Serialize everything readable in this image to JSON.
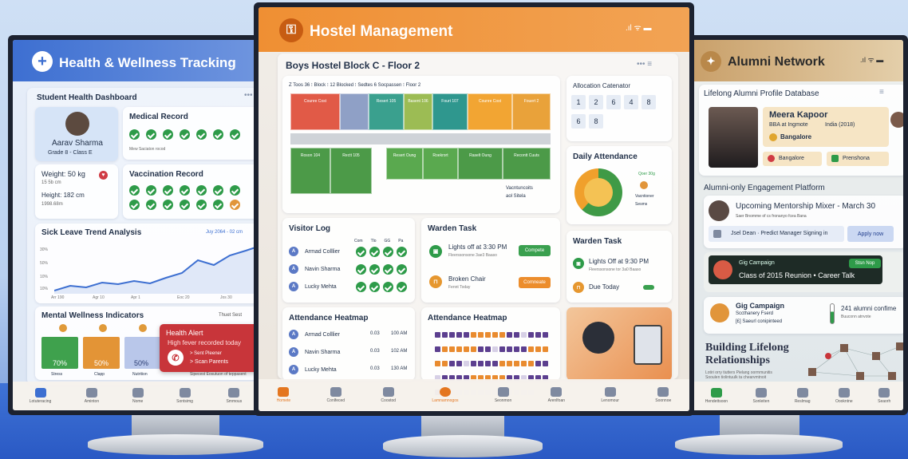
{
  "health": {
    "title": "Health & Wellness Tracking",
    "dashboard_title": "Student Health Dashboard",
    "student": {
      "name": "Aarav Sharma",
      "grade": "Grade 8 - Class E"
    },
    "weight": "Weight: 50 kg",
    "weight_sub": "15 5b cm",
    "height": "Height: 182 cm",
    "height_sub": "1998.68m",
    "medical_title": "Medical Record",
    "medical_sub": "Mew Saciaton rocod",
    "vaccination_title": "Vaccination Record",
    "sick_title": "Sick Leave Trend Analysis",
    "sick_legend": "Juy 2064 - 02 cm",
    "sick_yticks": [
      "30%",
      "50%",
      "10%",
      "10%"
    ],
    "sick_xticks": [
      "Arr 190",
      "Agr 10",
      "Apr 1",
      "Eoc 20",
      "Jos 30"
    ],
    "mental_title": "Mental Wellness Indicators",
    "mental_btn": "Thuet Sest",
    "bars": [
      {
        "label": "Stress",
        "value": "70%"
      },
      {
        "label": "Clapp",
        "value": "50%"
      },
      {
        "label": "Nutrition",
        "value": "50%"
      }
    ],
    "alert_title": "Health Alert",
    "alert_msg": "High fever recorded today",
    "alert_action1": "> Sent Pleener",
    "alert_action2": "> Scan Parents",
    "alert_footer": "Sipecest Eosutuon of teppasent",
    "nav": [
      "Lotuteracing",
      "Aminton",
      "Nome",
      "Sontsimg",
      "Smmous"
    ]
  },
  "hostel": {
    "title": "Hostel Management",
    "block_title": "Boys Hostel Block C - Floor 2",
    "floor_info": "Z  Toos 36  ⁝  Block  ⁝  12 Blocked  ⁝  Sedtes  6  Socpassen  ⁝  Floor 2",
    "rooms_top": [
      "Counre Cost",
      "",
      "Resert 105",
      "Basent 106",
      "Fourt 107",
      "Counre Cost",
      "Fouert 2"
    ],
    "rooms_bottom": [
      "Roson 104",
      "Rectt 105",
      "Resert Oung",
      "Roekrort",
      "Raselt Oung",
      "Recontt Cuuts"
    ],
    "floor_legend1": "Vacntuncoits",
    "floor_legend2": "aol Sitela",
    "calendar_title": "Allocation Catenator",
    "calendar_cells": [
      "1",
      "2",
      "6",
      "4",
      "8",
      "6",
      "8"
    ],
    "attendance_title": "Daily Attendance",
    "attendance_legend1": "Qoer 30g",
    "attendance_legend2": "Vacntioner",
    "attendance_legend3": "Sesms",
    "visitor_title": "Visitor Log",
    "visitor_cols": [
      "Com",
      "Tlo",
      "GG",
      "Pa"
    ],
    "visitors": [
      "Armad Colllier",
      "Navin Sharma",
      "Lucky Mehta"
    ],
    "warden1_title": "Warden Task",
    "warden1_task1": "Lights off at 3:30 PM",
    "warden1_task1_sub": "Fleerssonsone 3ae3 Baaso",
    "warden1_task1_btn": "Compete",
    "warden1_task2": "Broken Chair",
    "warden1_task2_sub": "Fennt Today",
    "warden1_task2_btn": "Comneate",
    "warden2_title": "Warden Task",
    "warden2_task1": "Lights Off at 9:30 PM",
    "warden2_task1_sub": "Fleerssonsone tor 3a0 Baaso",
    "warden2_task2": "Due Today",
    "heat1_title": "Attendance Heatmap",
    "heat1_rows": [
      {
        "name": "Armad Colllier",
        "v": "0.03",
        "t": "100 AM"
      },
      {
        "name": "Navin Sharma",
        "v": "0.03",
        "t": "102 AM"
      },
      {
        "name": "Lucky Mehta",
        "v": "0.03",
        "t": "130 AM"
      }
    ],
    "heat2_title": "Attendance Heatmap",
    "nav": [
      "Homete",
      "Conlfeced",
      "Coostod",
      "Lamnamnogos",
      "Seonmon",
      "Arenlfoan",
      "Lenomour",
      "Soonnoe"
    ]
  },
  "alumni": {
    "title": "Alumni Network",
    "db_title": "Lifelong Alumni Profile Database",
    "profile": {
      "name": "Meera Kapoor",
      "degree": "BBA at Ingmote",
      "location_year": "India (2018)",
      "city": "Bangalore"
    },
    "tag1": "Bangalore",
    "tag2": "Prenshona",
    "engage_title": "Alumni-only Engagement Platform",
    "mixer_title": "Upcoming Mentorship Mixer - March 30",
    "mixer_sub": "Saer Bnomme of cs fronanyo fcea Bana",
    "signin_text": "Jsel Dean · Predict Manager Signing in",
    "apply_btn": "Apply now",
    "gig1_title": "Gig Campaign",
    "gig1_sub": "Class of 2015 Reunion • Career Talk",
    "gig1_btn": "Stsn Nop",
    "gig2_title": "Gig Campaign",
    "gig2_sub": "Sccthanery Fserd",
    "gig2_sub2": "[£]  Saeurl conipinteed",
    "count": "241 alumni confime",
    "count_sub": "Buuconn atnvote",
    "building_title": "Building Lifelong Relationships",
    "building_sub": "Lotiri orry tiutters Pielang oormmunitis Sooulen tiolintuulk ta chearvmtnoit",
    "nav": [
      "Hendettsoon",
      "Sonleiten",
      "Reslmag",
      "Oookntne",
      "Seaorh"
    ]
  },
  "colors": {
    "hostel_orange": "#ef8f33",
    "health_blue": "#3d6fd1",
    "alumni_tan": "#c9a06a",
    "green": "#2e9b49",
    "alert_red": "#c8353a"
  }
}
